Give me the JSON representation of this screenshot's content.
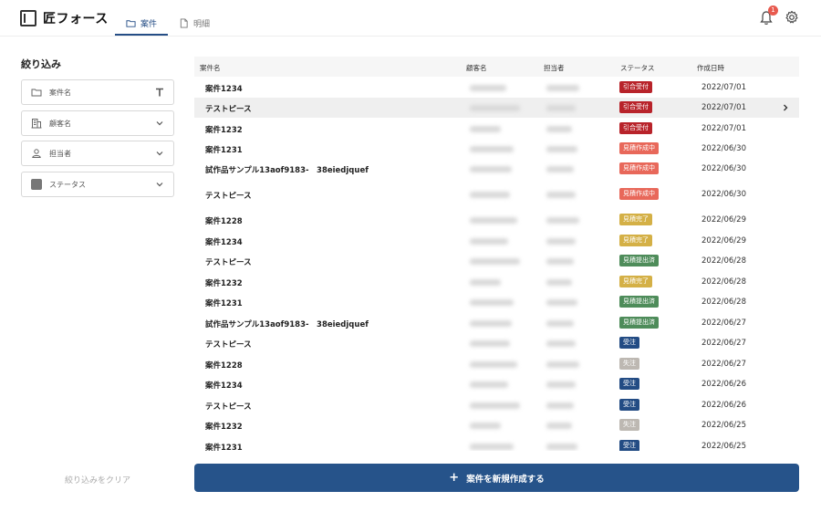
{
  "app": {
    "title": "匠フォース"
  },
  "nav": {
    "tabs": [
      {
        "label": "案件"
      },
      {
        "label": "明細"
      }
    ]
  },
  "notifications": {
    "count": "1"
  },
  "sidebar": {
    "title": "絞り込み",
    "filters": [
      {
        "label": "案件名",
        "icon": "folder-icon"
      },
      {
        "label": "顧客名",
        "icon": "building-icon"
      },
      {
        "label": "担当者",
        "icon": "person-icon"
      },
      {
        "label": "ステータス",
        "icon": "status-square-icon"
      }
    ],
    "clear_label": "絞り込みをクリア"
  },
  "table": {
    "headers": [
      "案件名",
      "顧客名",
      "担当者",
      "ステータス",
      "作成日時"
    ],
    "rows": [
      {
        "name": "案件1234",
        "status": "引合受付",
        "status_color": "#b8232a",
        "date": "2022/07/01"
      },
      {
        "name": "テストピース",
        "status": "引合受付",
        "status_color": "#b8232a",
        "date": "2022/07/01"
      },
      {
        "name": "案件1232",
        "status": "引合受付",
        "status_color": "#b8232a",
        "date": "2022/07/01"
      },
      {
        "name": "案件1231",
        "status": "見積作成中",
        "status_color": "#e8685a",
        "date": "2022/06/30"
      },
      {
        "name": "試作品サンプル13aof9183-　38eiedjquef",
        "status": "見積作成中",
        "status_color": "#e8685a",
        "date": "2022/06/30"
      },
      {
        "name": "テストピース",
        "status": "見積作成中",
        "status_color": "#e8685a",
        "date": "2022/06/30"
      },
      {
        "name": "案件1228",
        "status": "見積完了",
        "status_color": "#d4b046",
        "date": "2022/06/29"
      },
      {
        "name": "案件1234",
        "status": "見積完了",
        "status_color": "#d4b046",
        "date": "2022/06/29"
      },
      {
        "name": "テストピース",
        "status": "見積提出済",
        "status_color": "#4e8c5a",
        "date": "2022/06/28"
      },
      {
        "name": "案件1232",
        "status": "見積完了",
        "status_color": "#d4b046",
        "date": "2022/06/28"
      },
      {
        "name": "案件1231",
        "status": "見積提出済",
        "status_color": "#4e8c5a",
        "date": "2022/06/28"
      },
      {
        "name": "試作品サンプル13aof9183-　38eiedjquef",
        "status": "見積提出済",
        "status_color": "#4e8c5a",
        "date": "2022/06/27"
      },
      {
        "name": "テストピース",
        "status": "受注",
        "status_color": "#234c84",
        "date": "2022/06/27"
      },
      {
        "name": "案件1228",
        "status": "失注",
        "status_color": "#bdb8b2",
        "date": "2022/06/27"
      },
      {
        "name": "案件1234",
        "status": "受注",
        "status_color": "#234c84",
        "date": "2022/06/26"
      },
      {
        "name": "テストピース",
        "status": "受注",
        "status_color": "#234c84",
        "date": "2022/06/26"
      },
      {
        "name": "案件1232",
        "status": "失注",
        "status_color": "#bdb8b2",
        "date": "2022/06/25"
      },
      {
        "name": "案件1231",
        "status": "受注",
        "status_color": "#234c84",
        "date": "2022/06/25"
      }
    ]
  },
  "actions": {
    "create_label": "案件を新規作成する"
  }
}
